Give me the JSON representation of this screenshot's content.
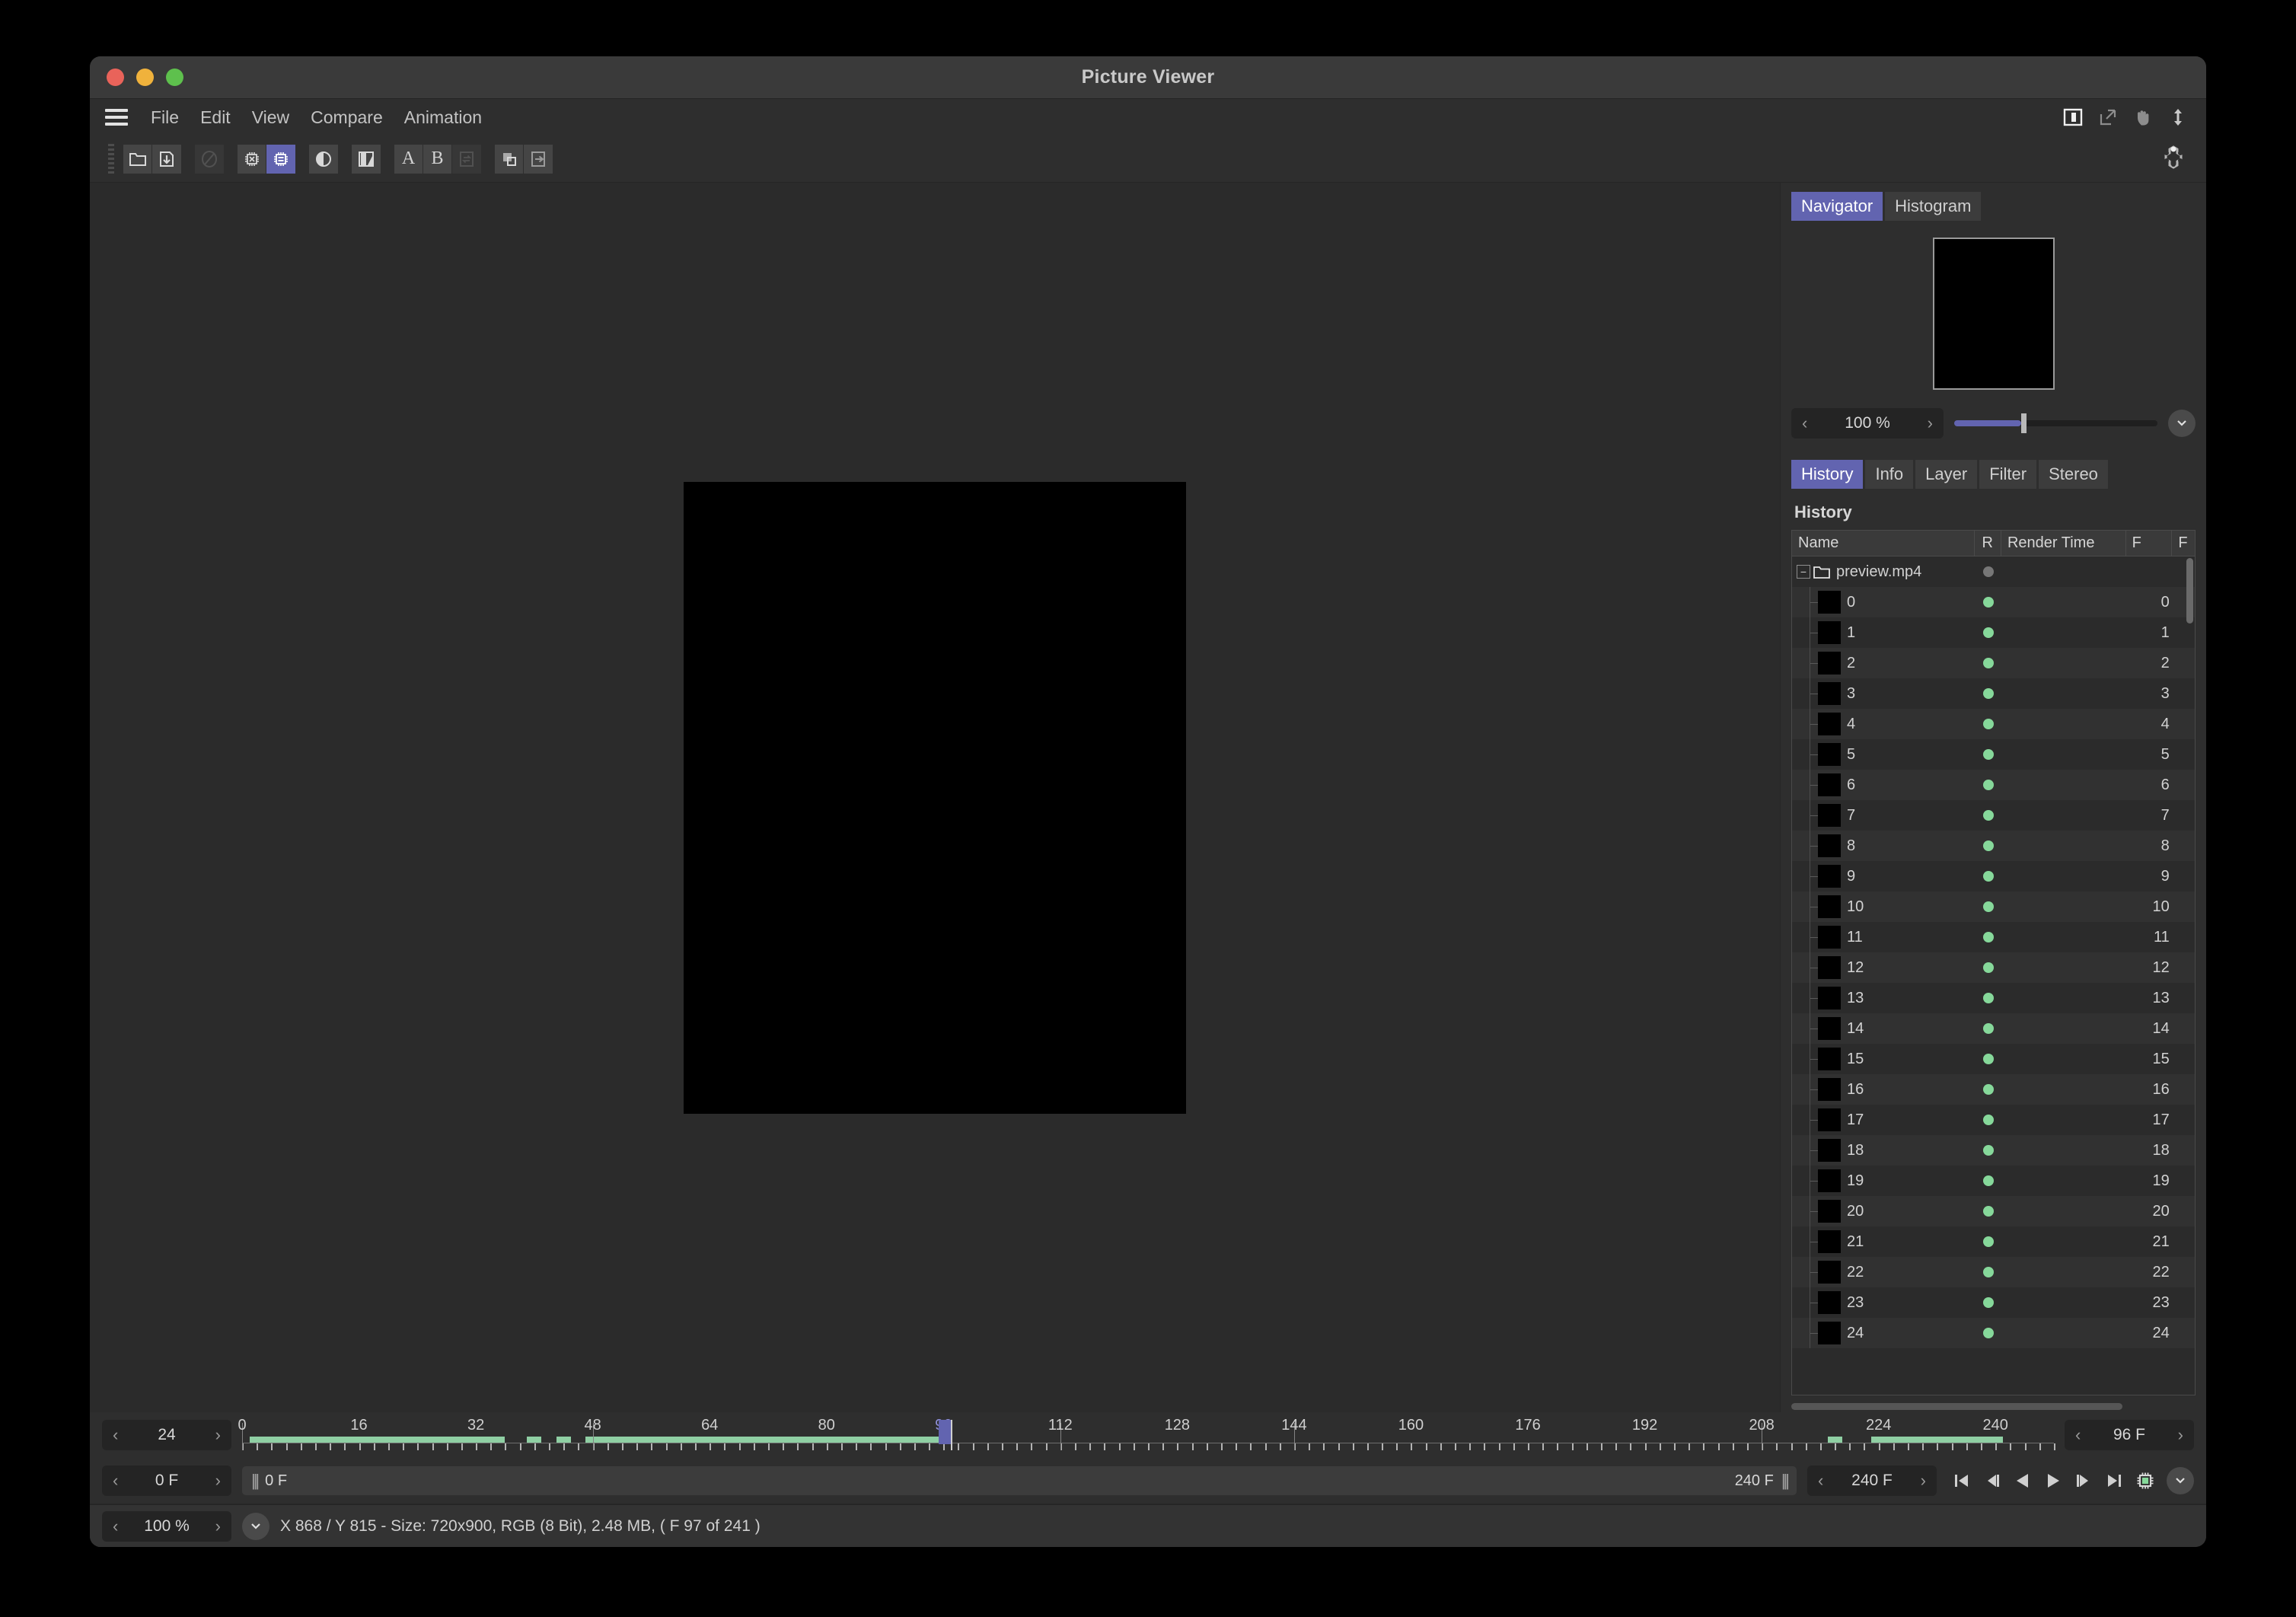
{
  "window": {
    "title": "Picture Viewer"
  },
  "menu": {
    "items": [
      "File",
      "Edit",
      "View",
      "Compare",
      "Animation"
    ]
  },
  "window_icons": [
    {
      "name": "split-panel-icon"
    },
    {
      "name": "external-link-icon"
    },
    {
      "name": "hand-pan-icon"
    },
    {
      "name": "vertical-arrows-icon"
    }
  ],
  "toolbar": {
    "groups": [
      {
        "buttons": [
          {
            "name": "open-folder-icon",
            "state": "normal"
          },
          {
            "name": "download-icon",
            "state": "normal"
          }
        ]
      },
      {
        "buttons": [
          {
            "name": "no-entry-icon",
            "state": "dim"
          }
        ]
      },
      {
        "buttons": [
          {
            "name": "chip-disable-icon",
            "state": "normal"
          },
          {
            "name": "chip-cache-icon",
            "state": "active"
          }
        ]
      },
      {
        "buttons": [
          {
            "name": "contrast-icon",
            "state": "normal"
          }
        ]
      },
      {
        "buttons": [
          {
            "name": "flip-compare-icon",
            "state": "normal"
          }
        ]
      },
      {
        "buttons": [
          {
            "name": "slot-a-button",
            "label": "A",
            "state": "normal"
          },
          {
            "name": "slot-b-button",
            "label": "B",
            "state": "normal"
          },
          {
            "name": "swap-ab-icon",
            "state": "dim"
          }
        ]
      },
      {
        "buttons": [
          {
            "name": "layers-icon",
            "state": "normal"
          },
          {
            "name": "export-icon",
            "state": "normal"
          }
        ]
      }
    ],
    "settings_icon": "node-hub-icon"
  },
  "navigator": {
    "tabs": [
      {
        "label": "Navigator",
        "active": true
      },
      {
        "label": "Histogram",
        "active": false
      }
    ],
    "zoom": "100 %",
    "slider_percent": 33,
    "expand_icon": "chevron-down-icon"
  },
  "inspector": {
    "tabs": [
      {
        "label": "History",
        "active": true
      },
      {
        "label": "Info",
        "active": false
      },
      {
        "label": "Layer",
        "active": false
      },
      {
        "label": "Filter",
        "active": false
      },
      {
        "label": "Stereo",
        "active": false
      }
    ],
    "section_title": "History",
    "columns": [
      "Name",
      "R",
      "Render Time",
      "F",
      "F"
    ],
    "root": {
      "name": "preview.mp4",
      "status": "gray"
    },
    "rows": [
      {
        "name": "0",
        "r": "green",
        "render_time": "",
        "f": "0"
      },
      {
        "name": "1",
        "r": "green",
        "render_time": "",
        "f": "1"
      },
      {
        "name": "2",
        "r": "green",
        "render_time": "",
        "f": "2"
      },
      {
        "name": "3",
        "r": "green",
        "render_time": "",
        "f": "3"
      },
      {
        "name": "4",
        "r": "green",
        "render_time": "",
        "f": "4"
      },
      {
        "name": "5",
        "r": "green",
        "render_time": "",
        "f": "5"
      },
      {
        "name": "6",
        "r": "green",
        "render_time": "",
        "f": "6"
      },
      {
        "name": "7",
        "r": "green",
        "render_time": "",
        "f": "7"
      },
      {
        "name": "8",
        "r": "green",
        "render_time": "",
        "f": "8"
      },
      {
        "name": "9",
        "r": "green",
        "render_time": "",
        "f": "9"
      },
      {
        "name": "10",
        "r": "green",
        "render_time": "",
        "f": "10"
      },
      {
        "name": "11",
        "r": "green",
        "render_time": "",
        "f": "11"
      },
      {
        "name": "12",
        "r": "green",
        "render_time": "",
        "f": "12"
      },
      {
        "name": "13",
        "r": "green",
        "render_time": "",
        "f": "13"
      },
      {
        "name": "14",
        "r": "green",
        "render_time": "",
        "f": "14"
      },
      {
        "name": "15",
        "r": "green",
        "render_time": "",
        "f": "15"
      },
      {
        "name": "16",
        "r": "green",
        "render_time": "",
        "f": "16"
      },
      {
        "name": "17",
        "r": "green",
        "render_time": "",
        "f": "17"
      },
      {
        "name": "18",
        "r": "green",
        "render_time": "",
        "f": "18"
      },
      {
        "name": "19",
        "r": "green",
        "render_time": "",
        "f": "19"
      },
      {
        "name": "20",
        "r": "green",
        "render_time": "",
        "f": "20"
      },
      {
        "name": "21",
        "r": "green",
        "render_time": "",
        "f": "21"
      },
      {
        "name": "22",
        "r": "green",
        "render_time": "",
        "f": "22"
      },
      {
        "name": "23",
        "r": "green",
        "render_time": "",
        "f": "23"
      },
      {
        "name": "24",
        "r": "green",
        "render_time": "",
        "f": "24"
      }
    ]
  },
  "timeline": {
    "fps": "24",
    "frame_start_field": "0 F",
    "range_left_label": "0 F",
    "range_right_label": "240 F",
    "end_field": "96 F",
    "total_field": "240 F",
    "tick_labels": [
      "0",
      "16",
      "32",
      "48",
      "64",
      "80",
      "96",
      "112",
      "128",
      "144",
      "160",
      "176",
      "192",
      "208",
      "224",
      "240"
    ],
    "current_label": "96",
    "playhead_frame": 97,
    "max_frame": 248,
    "cache_ranges": [
      {
        "from": 1,
        "to": 36
      },
      {
        "from": 39,
        "to": 41
      },
      {
        "from": 43,
        "to": 45
      },
      {
        "from": 47,
        "to": 97
      },
      {
        "from": 217,
        "to": 219
      },
      {
        "from": 223,
        "to": 241
      }
    ],
    "transport": [
      {
        "name": "go-to-start-icon"
      },
      {
        "name": "step-back-icon"
      },
      {
        "name": "play-backward-icon"
      },
      {
        "name": "play-icon"
      },
      {
        "name": "step-forward-icon"
      },
      {
        "name": "go-to-end-icon"
      },
      {
        "name": "render-chip-icon"
      },
      {
        "name": "chevron-down-icon"
      }
    ]
  },
  "statusbar": {
    "zoom": "100 %",
    "expand_icon": "chevron-down-icon",
    "text": "X 868 / Y 815 - Size: 720x900, RGB (8 Bit), 2.48 MB,  ( F 97 of 241 )"
  }
}
